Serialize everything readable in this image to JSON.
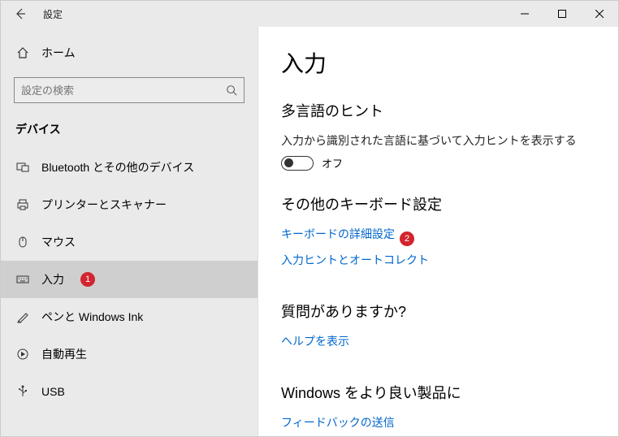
{
  "titlebar": {
    "title": "設定"
  },
  "sidebar": {
    "home": "ホーム",
    "search_placeholder": "設定の検索",
    "group": "デバイス",
    "items": [
      {
        "label": "Bluetooth とその他のデバイス"
      },
      {
        "label": "プリンターとスキャナー"
      },
      {
        "label": "マウス"
      },
      {
        "label": "入力",
        "selected": true,
        "badge": "1"
      },
      {
        "label": "ペンと Windows Ink"
      },
      {
        "label": "自動再生"
      },
      {
        "label": "USB"
      }
    ]
  },
  "main": {
    "h1": "入力",
    "sec1": {
      "title": "多言語のヒント",
      "desc": "入力から識別された言語に基づいて入力ヒントを表示する",
      "toggle_label": "オフ"
    },
    "sec2": {
      "title": "その他のキーボード設定",
      "link1": "キーボードの詳細設定",
      "badge2": "2",
      "link2": "入力ヒントとオートコレクト"
    },
    "sec3": {
      "title": "質問がありますか?",
      "link": "ヘルプを表示"
    },
    "sec4": {
      "title": "Windows をより良い製品に",
      "link": "フィードバックの送信"
    }
  }
}
